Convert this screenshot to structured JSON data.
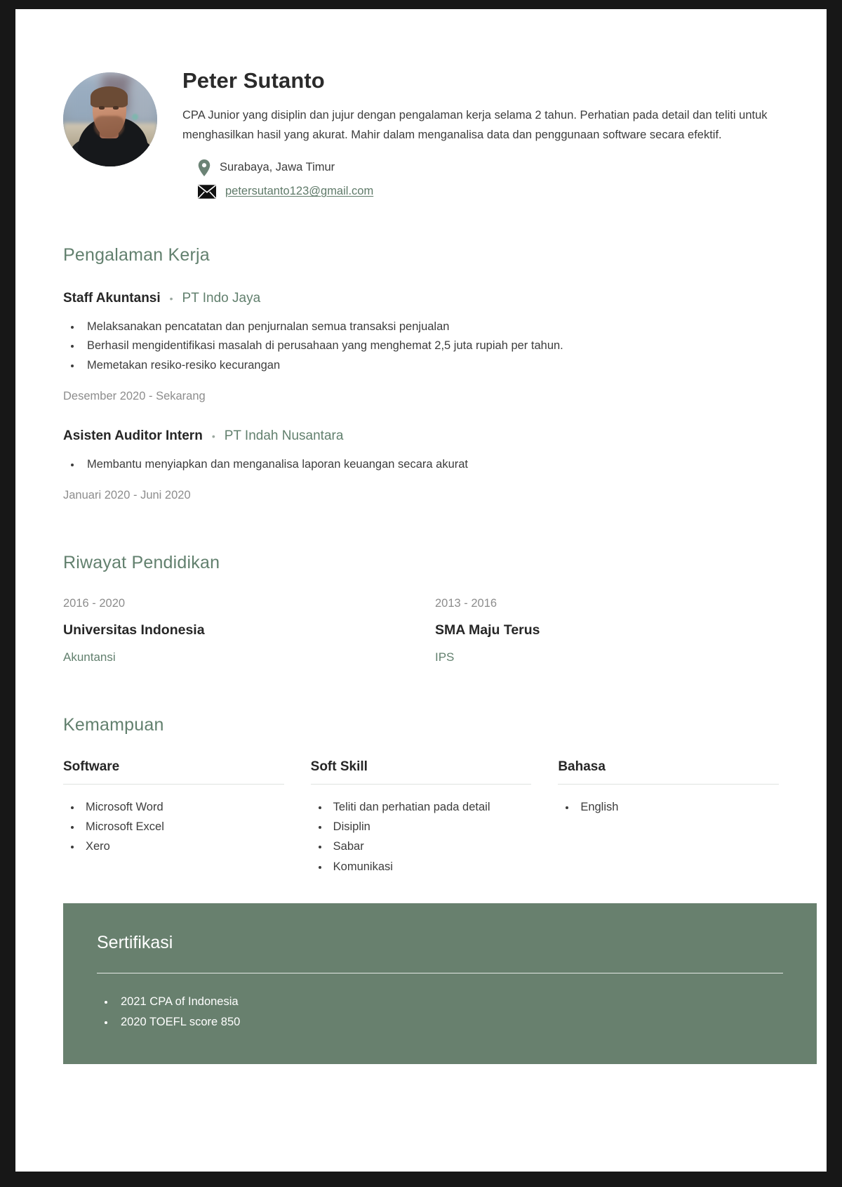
{
  "profile": {
    "name": "Peter Sutanto",
    "summary": "CPA Junior yang disiplin dan jujur dengan pengalaman kerja selama 2 tahun. Perhatian pada detail dan teliti untuk menghasilkan hasil yang akurat. Mahir dalam menganalisa data dan penggunaan software secara efektif.",
    "location": "Surabaya, Jawa Timur",
    "email": "petersutanto123@gmail.com",
    "location_icon": "location-pin-icon",
    "email_icon": "envelope-icon",
    "avatar_alt": "profile-photo"
  },
  "experience": {
    "title": "Pengalaman Kerja",
    "separator": "•",
    "jobs": [
      {
        "role": "Staff Akuntansi",
        "company": "PT Indo Jaya",
        "bullets": [
          "Melaksanakan pencatatan dan penjurnalan semua transaksi penjualan",
          "Berhasil mengidentifikasi masalah di perusahaan yang menghemat 2,5 juta rupiah per tahun.",
          "Memetakan resiko-resiko kecurangan"
        ],
        "dates": "Desember 2020 - Sekarang"
      },
      {
        "role": "Asisten Auditor Intern",
        "company": "PT Indah Nusantara",
        "bullets": [
          "Membantu menyiapkan dan menganalisa laporan keuangan secara akurat"
        ],
        "dates": "Januari 2020 - Juni 2020"
      }
    ]
  },
  "education": {
    "title": "Riwayat Pendidikan",
    "entries": [
      {
        "years": "2016 - 2020",
        "school": "Universitas Indonesia",
        "major": "Akuntansi"
      },
      {
        "years": "2013 - 2016",
        "school": "SMA Maju Terus",
        "major": "IPS"
      }
    ]
  },
  "skills": {
    "title": "Kemampuan",
    "categories": [
      {
        "label": "Software",
        "items": [
          "Microsoft Word",
          "Microsoft Excel",
          "Xero"
        ]
      },
      {
        "label": "Soft Skill",
        "items": [
          "Teliti dan perhatian pada detail",
          "Disiplin",
          "Sabar",
          "Komunikasi"
        ]
      },
      {
        "label": "Bahasa",
        "items": [
          "English"
        ]
      }
    ]
  },
  "certification": {
    "title": "Sertifikasi",
    "items": [
      "2021 CPA of Indonesia",
      "2020 TOEFL score 850"
    ]
  },
  "colors": {
    "accent_green": "#62806e",
    "band_green": "#68806e",
    "text_dark": "#262626",
    "text_body": "#3d3d3d",
    "text_muted": "#8d8d8d",
    "page_background": "#ffffff",
    "frame": "#171717"
  }
}
